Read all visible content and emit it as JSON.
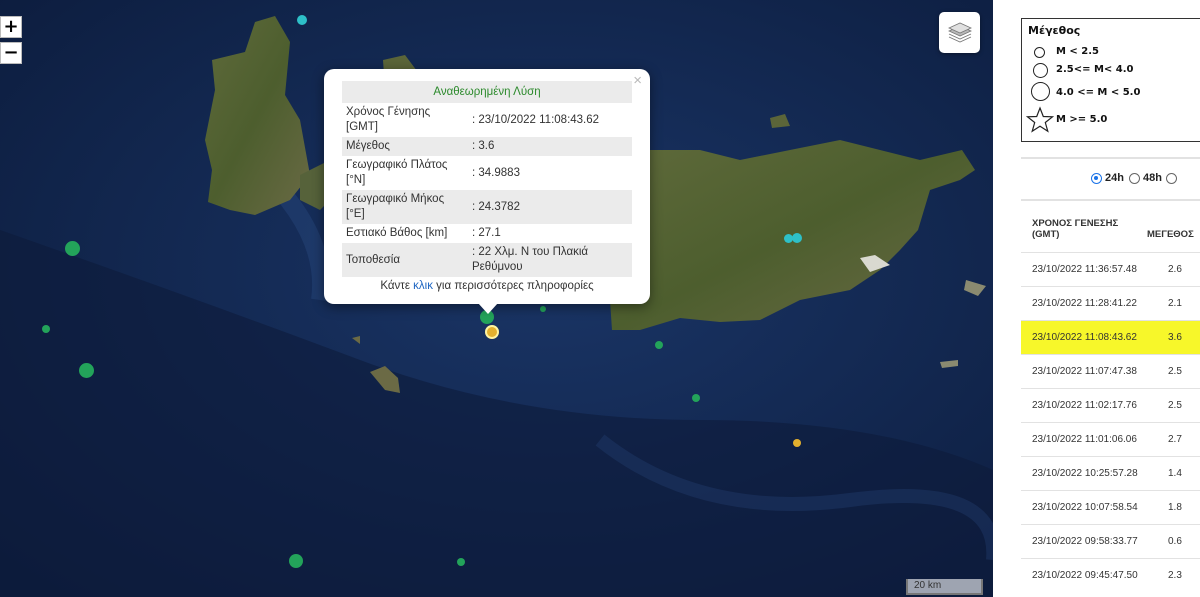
{
  "map": {
    "zoom_in_label": "+",
    "zoom_out_label": "−",
    "scale_label": "20 km",
    "quakes": [
      {
        "color": "#23a35a"
      },
      {
        "color": "#23a35a"
      },
      {
        "color": "#23a35a"
      },
      {
        "color": "#23a35a"
      },
      {
        "color": "#23a35a"
      },
      {
        "color": "#23a35a"
      },
      {
        "color": "#23a35a"
      },
      {
        "color": "#23a35a"
      },
      {
        "color": "#23a35a"
      },
      {
        "color": "#2ec0c8"
      },
      {
        "color": "#2ec0c8"
      },
      {
        "color": "#2ec0c8"
      },
      {
        "color": "#e3b02e"
      },
      {
        "color": "#e3b02e"
      }
    ]
  },
  "popup": {
    "title": "Αναθεωρημένη Λύση",
    "rows": [
      {
        "label": "Χρόνος Γένησης [GMT]",
        "value": ": 23/10/2022 11:08:43.62"
      },
      {
        "label": "Μέγεθος",
        "value": ": 3.6"
      },
      {
        "label": "Γεωγραφικό Πλάτος [°N]",
        "value": ": 34.9883"
      },
      {
        "label": "Γεωγραφικό Μήκος [°E]",
        "value": ": 24.3782"
      },
      {
        "label": "Εστιακό Βάθος [km]",
        "value": ": 27.1"
      },
      {
        "label": "Τοποθεσία",
        "value": ": 22 Χλμ. Ν του Πλακιά Ρεθύμνου"
      }
    ],
    "more_prefix": "Κάντε ",
    "more_link": "κλικ",
    "more_suffix": " για περισσότερες πληροφορίες",
    "close_label": "×"
  },
  "legend": {
    "title": "Μέγεθος",
    "items": [
      "M < 2.5",
      "2.5<= M< 4.0",
      "4.0 <= M < 5.0",
      "M >= 5.0"
    ]
  },
  "filter": {
    "options": [
      "24h",
      "48h"
    ],
    "selected": "24h"
  },
  "table": {
    "headers": [
      "ΧΡΟΝΟΣ ΓΕΝΕΣΗΣ (GMT)",
      "ΜΕΓΕΘΟΣ"
    ],
    "rows": [
      {
        "time": "23/10/2022 11:36:57.48",
        "mag": "2.6"
      },
      {
        "time": "23/10/2022 11:28:41.22",
        "mag": "2.1"
      },
      {
        "time": "23/10/2022 11:08:43.62",
        "mag": "3.6",
        "highlight": true
      },
      {
        "time": "23/10/2022 11:07:47.38",
        "mag": "2.5"
      },
      {
        "time": "23/10/2022 11:02:17.76",
        "mag": "2.5"
      },
      {
        "time": "23/10/2022 11:01:06.06",
        "mag": "2.7"
      },
      {
        "time": "23/10/2022 10:25:57.28",
        "mag": "1.4"
      },
      {
        "time": "23/10/2022 10:07:58.54",
        "mag": "1.8"
      },
      {
        "time": "23/10/2022 09:58:33.77",
        "mag": "0.6"
      },
      {
        "time": "23/10/2022 09:45:47.50",
        "mag": "2.3"
      }
    ]
  }
}
